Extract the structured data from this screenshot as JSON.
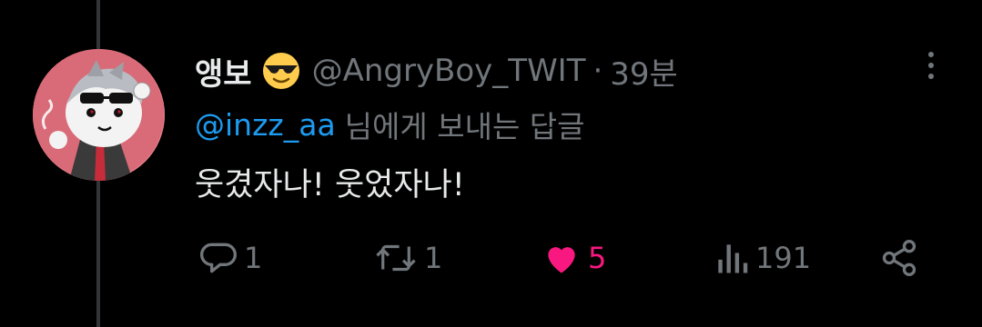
{
  "tweet": {
    "display_name": "앵보",
    "emoji": "sunglasses-emoji",
    "handle": "@AngryBoy_TWIT",
    "separator": "·",
    "time": "39분",
    "reply_to": {
      "mention": "@inzz_aa",
      "suffix": "님에게 보내는 답글"
    },
    "text": "웃겼자나! 웃었자나!"
  },
  "actions": {
    "reply_count": "1",
    "retweet_count": "1",
    "like_count": "5",
    "views_count": "191"
  },
  "icons": {
    "reply": "reply-icon",
    "retweet": "retweet-icon",
    "like": "heart-icon",
    "views": "views-icon",
    "share": "share-icon",
    "more": "more-dots-icon"
  },
  "colors": {
    "background": "#000000",
    "text": "#e7e9ea",
    "muted": "#71767b",
    "mention": "#1d9bf0",
    "like": "#f91880"
  }
}
